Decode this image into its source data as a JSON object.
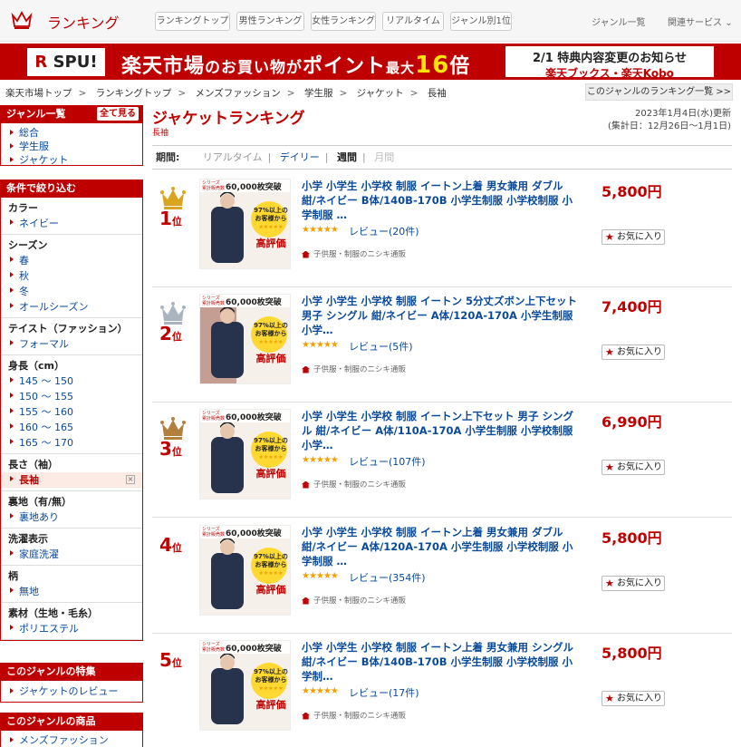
{
  "header": {
    "logo_text": "ランキング",
    "nav": [
      "ランキングトップ",
      "男性ランキング",
      "女性ランキング",
      "リアルタイム",
      "ジャンル別1位"
    ],
    "links": [
      "ジャンル一覧",
      "関連サービス"
    ]
  },
  "banner": {
    "spu_r": "R",
    "spu": "SPU!",
    "main_a": "楽天市場",
    "main_b": "のお買い物が",
    "main_c": "ポイント",
    "main_d": "最大",
    "main_e": "16",
    "main_f": "倍",
    "news1": "2/1 特典内容変更のお知らせ",
    "news2": "楽天ブックス・楽天Kobo"
  },
  "breadcrumb": {
    "items": [
      "楽天市場トップ",
      "ランキングトップ",
      "メンズファッション",
      "学生服",
      "ジャケット",
      "長袖"
    ],
    "sep": ">",
    "genre_list_label": "このジャンルのランキング一覧 >>"
  },
  "sidebar": {
    "genre_title": "ジャンル一覧",
    "see_all": "全て見る",
    "genre_items": [
      "総合",
      "学生服",
      "ジャケット"
    ],
    "filter_title": "条件で絞り込む",
    "groups": [
      {
        "title": "カラー",
        "items": [
          "ネイビー"
        ]
      },
      {
        "title": "シーズン",
        "items": [
          "春",
          "秋",
          "冬",
          "オールシーズン"
        ]
      },
      {
        "title": "テイスト（ファッション）",
        "items": [
          "フォーマル"
        ]
      },
      {
        "title": "身長（cm）",
        "items": [
          "145 ～ 150",
          "150 ～ 155",
          "155 ～ 160",
          "160 ～ 165",
          "165 ～ 170"
        ]
      },
      {
        "title": "長さ（袖）",
        "items": [
          "長袖"
        ],
        "selected": "長袖"
      },
      {
        "title": "裏地（有/無）",
        "items": [
          "裏地あり"
        ]
      },
      {
        "title": "洗濯表示",
        "items": [
          "家庭洗濯"
        ]
      },
      {
        "title": "柄",
        "items": [
          "無地"
        ]
      },
      {
        "title": "素材（生地・毛糸）",
        "items": [
          "ポリエステル"
        ]
      }
    ],
    "feature_title": "このジャンルの特集",
    "feature_items": [
      "ジャケットのレビュー"
    ],
    "products_title": "このジャンルの商品",
    "products_items": [
      "メンズファッション"
    ]
  },
  "main": {
    "title": "ジャケットランキング",
    "subtitle": "長袖",
    "updated": "2023年1月4日(水)更新",
    "period_range": "(集計日：12月26日～1月1日)",
    "period_label": "期間:",
    "period_options": [
      "リアルタイム",
      "デイリー",
      "週間",
      "月間"
    ],
    "period_selected": "週間",
    "fav_label": "お気に入り",
    "rank_suffix": "位",
    "colors": {
      "accent": "#bf0000",
      "link": "#0a4a9a",
      "gold": "#d9a520",
      "silver": "#aab4c0",
      "bronze": "#b0803c"
    },
    "thumb": {
      "badge_a": "シリーズ",
      "badge_b": "累計販売数",
      "sales": "60,000枚突破",
      "big": "97%以上の",
      "mid": "お客様から",
      "stars": "★★★★★",
      "tail": "高評価"
    },
    "items": [
      {
        "rank": "1",
        "medal": "gold",
        "name": "小学 小学生 小学校 制服 イートン上着 男女兼用 ダブル 紺/ネイビー B体/140B-170B 小学生制服 小学校制服 小学制服 …",
        "price": "5,800円",
        "stars": "★★★★★",
        "review": "レビュー(20件)",
        "shop": "子供服・制服のニシキ通販"
      },
      {
        "rank": "2",
        "medal": "silver",
        "name": "小学 小学生 小学校 制服 イートン 5分丈ズボン上下セット 男子 シングル 紺/ネイビー A体/120A-170A 小学生制服 小学…",
        "price": "7,400円",
        "stars": "★★★★★",
        "review": "レビュー(5件)",
        "shop": "子供服・制服のニシキ通販"
      },
      {
        "rank": "3",
        "medal": "bronze",
        "name": "小学 小学生 小学校 制服 イートン上下セット 男子 シングル 紺/ネイビー A体/110A-170A 小学生制服 小学校制服 小学…",
        "price": "6,990円",
        "stars": "★★★★★",
        "review": "レビュー(107件)",
        "shop": "子供服・制服のニシキ通販"
      },
      {
        "rank": "4",
        "medal": "",
        "name": "小学 小学生 小学校 制服 イートン上着 男女兼用 ダブル 紺/ネイビー A体/120A-170A 小学生制服 小学校制服 小学制服 …",
        "price": "5,800円",
        "stars": "★★★★★",
        "review": "レビュー(354件)",
        "shop": "子供服・制服のニシキ通販"
      },
      {
        "rank": "5",
        "medal": "",
        "name": "小学 小学生 小学校 制服 イートン上着 男女兼用 シングル 紺/ネイビー B体/140B-170B 小学生制服 小学校制服 小学制…",
        "price": "5,800円",
        "stars": "★★★★★",
        "review": "レビュー(17件)",
        "shop": "子供服・制服のニシキ通販"
      }
    ]
  }
}
